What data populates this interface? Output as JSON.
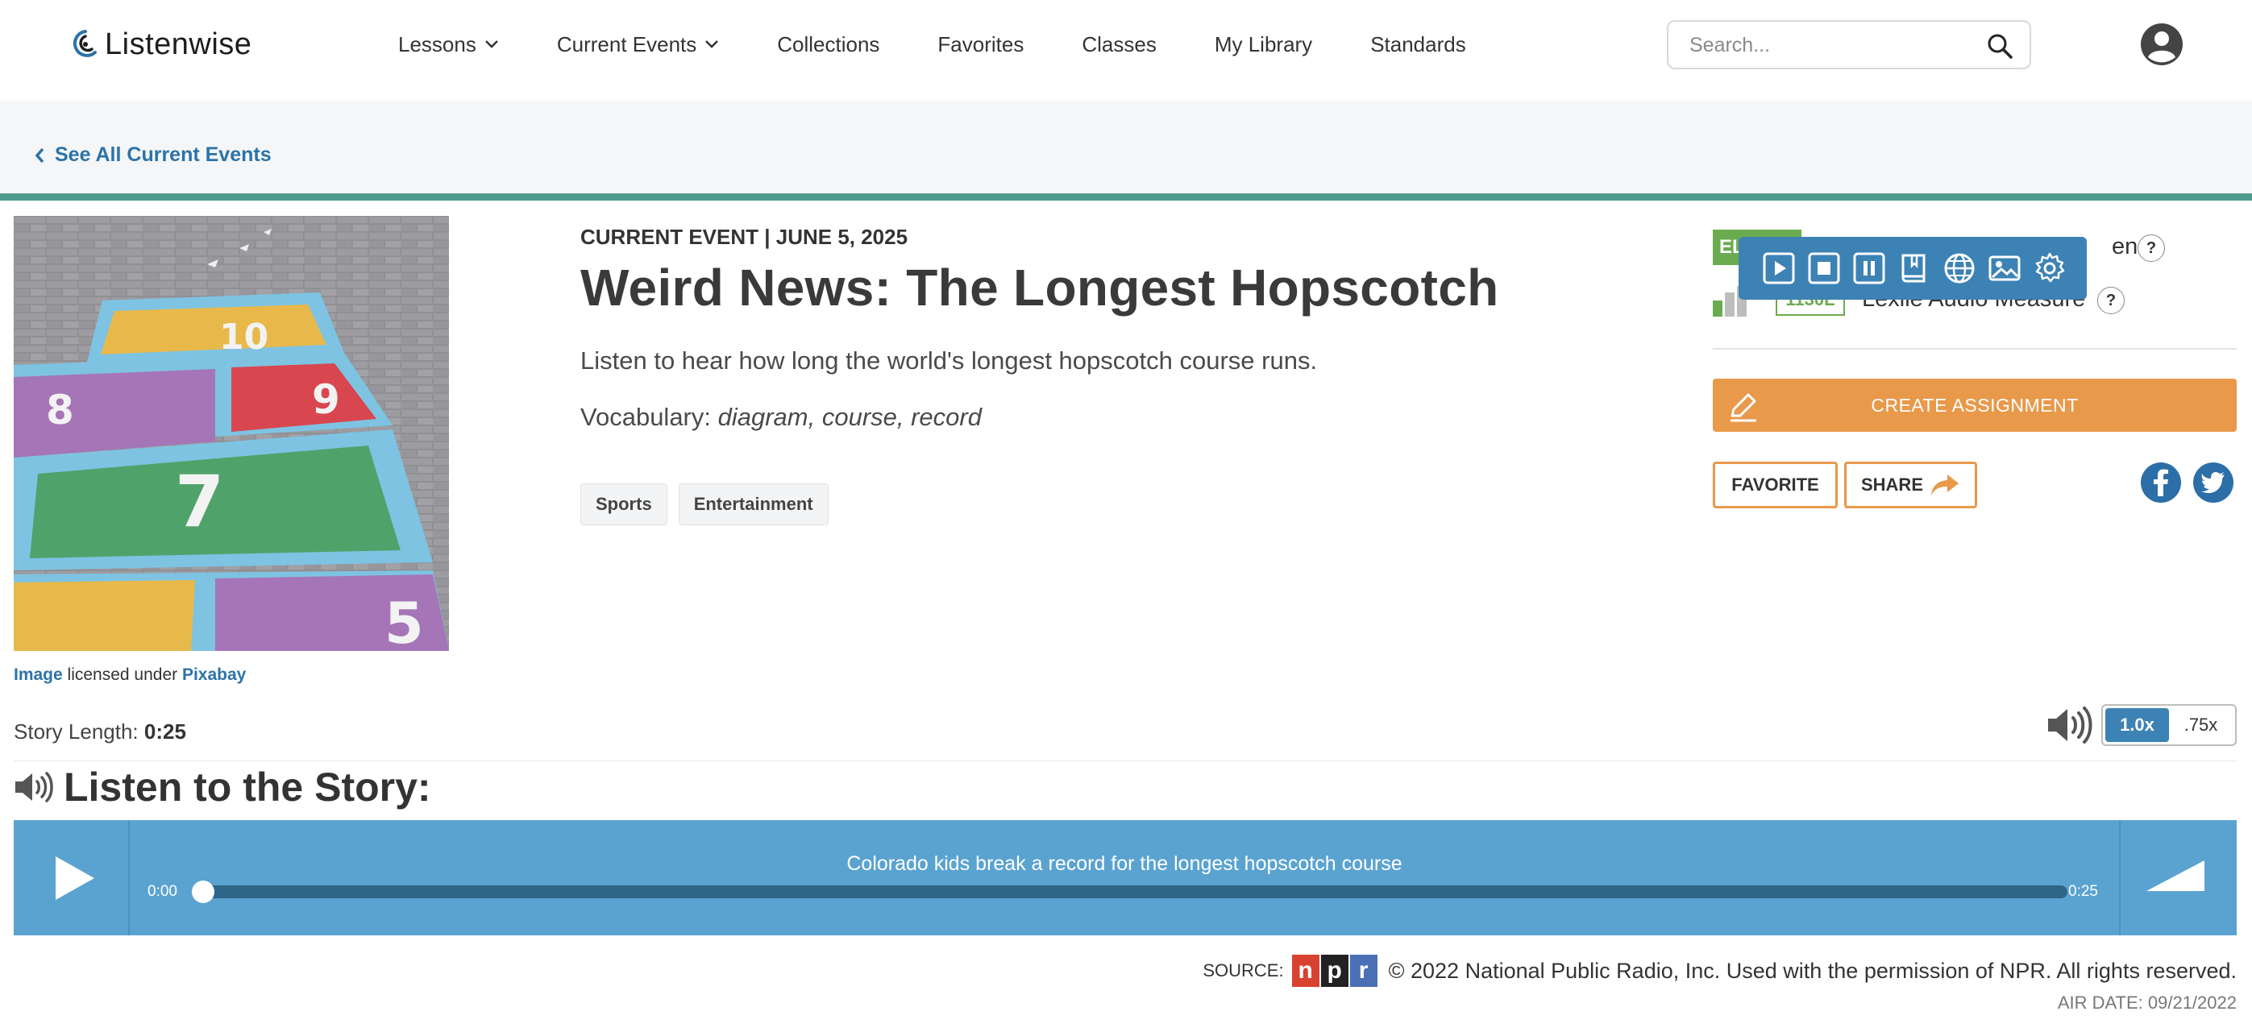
{
  "nav": {
    "logo_text": "Listenwise",
    "items": [
      {
        "label": "Lessons",
        "has_dropdown": true
      },
      {
        "label": "Current Events",
        "has_dropdown": true
      },
      {
        "label": "Collections",
        "has_dropdown": false
      },
      {
        "label": "Favorites",
        "has_dropdown": false
      },
      {
        "label": "Classes",
        "has_dropdown": false
      },
      {
        "label": "My Library",
        "has_dropdown": false
      },
      {
        "label": "Standards",
        "has_dropdown": false
      }
    ],
    "search_placeholder": "Search..."
  },
  "breadcrumb": {
    "label": "See All Current Events"
  },
  "image_credit": {
    "image_link": "Image",
    "middle": " licensed under ",
    "source_link": "Pixabay"
  },
  "story_length": {
    "label": "Story Length: ",
    "value": "0:25"
  },
  "article": {
    "kicker": "CURRENT EVENT | JUNE 5, 2025",
    "title": "Weird News: The Longest Hopscotch",
    "summary": "Listen to hear how long the world's longest hopscotch course runs.",
    "vocab_label": "Vocabulary: ",
    "vocab_words": "diagram, course, record",
    "tags": [
      "Sports",
      "Entertainment"
    ]
  },
  "levels": {
    "badge": "EL",
    "proficiency_text": "ency",
    "lexile_badge": "1130L",
    "lexile_text": "Lexile Audio Measure",
    "help": "?"
  },
  "reader_toolbar": {
    "buttons": [
      "play-icon",
      "stop-icon",
      "pause-icon",
      "dictionary-icon",
      "translate-icon",
      "picture-dictionary-icon",
      "settings-icon"
    ]
  },
  "actions": {
    "create_assignment": "CREATE ASSIGNMENT",
    "favorite": "FAVORITE",
    "share": "SHARE"
  },
  "playback_speed": {
    "options": [
      "1.0x",
      ".75x"
    ],
    "selected": "1.0x"
  },
  "listen_heading": "Listen to the Story:",
  "player": {
    "track_title": "Colorado kids break a record for the longest hopscotch course",
    "current_time": "0:00",
    "duration": "0:25",
    "progress": 0.0
  },
  "source": {
    "label": "SOURCE:",
    "npr_letters": [
      "n",
      "p",
      "r"
    ],
    "copyright": "© 2022 National Public Radio, Inc. Used with the permission of NPR. All rights reserved.",
    "air_date": "AIR DATE: 09/21/2022"
  },
  "colors": {
    "accent_blue": "#3d82b4",
    "player_blue": "#5aa3d1",
    "orange": "#e8994a",
    "green": "#6bab4f",
    "teal_rule": "#4f9a8e",
    "npr_red": "#d8422f",
    "npr_black": "#222222",
    "npr_blue": "#4a6fb5"
  }
}
